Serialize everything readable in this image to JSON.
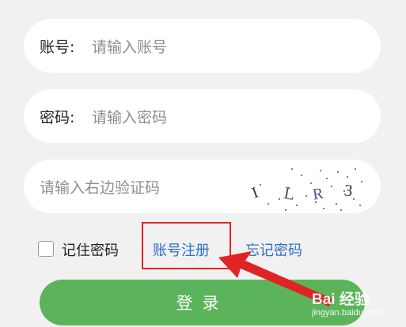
{
  "account": {
    "label": "账号:",
    "placeholder": "请输入账号"
  },
  "password": {
    "label": "密码:",
    "placeholder": "请输入密码"
  },
  "captcha": {
    "placeholder": "请输入右边验证码",
    "code": [
      "I",
      "L",
      "R",
      "3"
    ]
  },
  "options": {
    "remember": "记住密码",
    "register": "账号注册",
    "forgot": "忘记密码"
  },
  "login": {
    "label": "登录"
  },
  "colors": {
    "primary": "#5cb45a",
    "link": "#2f6fc6",
    "annotation": "#e02424"
  },
  "watermark": {
    "top": "Bai 经验",
    "bottom": "jingyan.baidu.com"
  }
}
